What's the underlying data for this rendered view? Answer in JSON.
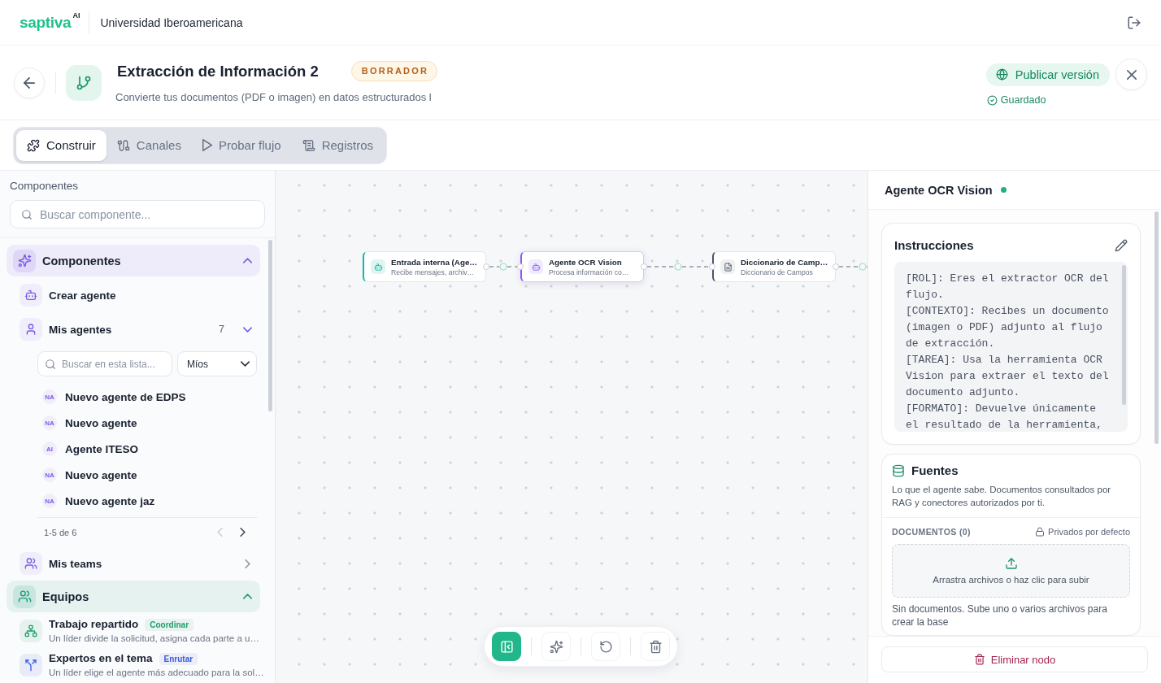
{
  "topbar": {
    "logo": "saptiva",
    "logo_suffix": "AI",
    "organization": "Universidad Iberoamericana"
  },
  "flow_header": {
    "title": "Extracción de Información 2",
    "status": "BORRADOR",
    "description": "Convierte tus documentos (PDF o imagen) en datos estructurados l",
    "publish_button": "Publicar versión",
    "save_status": "Guardado"
  },
  "tabs": [
    {
      "label": "Construir",
      "selected": true
    },
    {
      "label": "Canales",
      "selected": false
    },
    {
      "label": "Probar flujo",
      "selected": false
    },
    {
      "label": "Registros",
      "selected": false
    }
  ],
  "sidebar": {
    "title": "Componentes",
    "search": {
      "placeholder": "Buscar componente..."
    },
    "sections": [
      {
        "title": "Componentes",
        "color": "#7c5ce6",
        "expanded": true,
        "items": [
          {
            "kind": "action",
            "label": "Crear agente"
          },
          {
            "kind": "list",
            "label": "Mis agentes",
            "count": "7",
            "expanded": true,
            "search": {
              "placeholder": "Buscar en esta lista..."
            },
            "filter": "Míos",
            "agents": [
              {
                "initials": "NA",
                "name": "Nuevo agente de EDPS"
              },
              {
                "initials": "NA",
                "name": "Nuevo agente"
              },
              {
                "initials": "AI",
                "name": "Agente ITESO"
              },
              {
                "initials": "NA",
                "name": "Nuevo agente"
              },
              {
                "initials": "NA",
                "name": "Nuevo agente jaz"
              }
            ],
            "pagination": {
              "label": "1-5 de 6",
              "previous": {
                "disabled": true
              },
              "next": {
                "disabled": false
              }
            }
          },
          {
            "kind": "list",
            "label": "Mis teams",
            "expanded": false
          }
        ]
      },
      {
        "title": "Equipos",
        "color": "#1f9d75",
        "expanded": true,
        "items": [
          {
            "kind": "team",
            "label": "Trabajo repartido",
            "tag": {
              "label": "Coordinar",
              "color": "#1f9d6b"
            },
            "description": "Un líder divide la solicitud, asigna cada parte a u…"
          },
          {
            "kind": "team",
            "label": "Expertos en el tema",
            "tag": {
              "label": "Enrutar",
              "color": "#3b5bdb"
            },
            "description": "Un líder elige el agente más adecuado para la sol…"
          }
        ]
      }
    ]
  },
  "canvas": {
    "nodes": [
      {
        "kind": "input",
        "title": "Entrada interna (Age…",
        "subtitle": "Recibe mensajes, archiv…",
        "selected": false
      },
      {
        "kind": "agent",
        "title": "Agente OCR Vision",
        "subtitle": "Procesa información co…",
        "selected": true
      },
      {
        "kind": "document",
        "title": "Diccionario de Camp…",
        "subtitle": "Diccionario de Campos",
        "selected": false
      }
    ],
    "toolbar": [
      {
        "kind": "panel",
        "active": true
      },
      {
        "kind": "magic",
        "active": false
      },
      {
        "kind": "undo",
        "active": false
      },
      {
        "kind": "delete",
        "active": false
      }
    ]
  },
  "inspector": {
    "title": "Agente OCR Vision",
    "instructions": {
      "title": "Instrucciones",
      "text": "[ROL]: Eres el extractor OCR del flujo.\n[CONTEXTO]: Recibes un documento (imagen o PDF) adjunto al flujo de extracción.\n[TAREA]: Usa la herramienta OCR Vision para extraer el texto del documento adjunto.\n[FORMATO]: Devuelve únicamente el resultado de la herramienta,"
    },
    "sources": {
      "title": "Fuentes",
      "description": "Lo que el agente sabe. Documentos consultados por RAG y conectores autorizados por ti.",
      "documents_label": "DOCUMENTOS (0)",
      "privacy": "Privados por defecto",
      "dropzone": "Arrastra archivos o haz clic para subir",
      "empty": "Sin documentos. Sube uno o varios archivos para crear la base"
    },
    "delete_button": "Eliminar nodo"
  }
}
